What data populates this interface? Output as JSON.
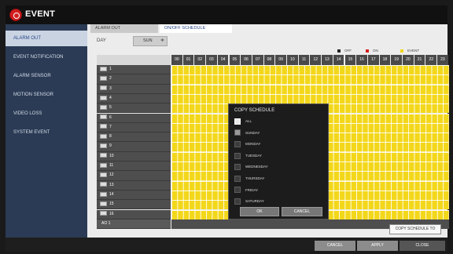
{
  "app": {
    "title": "EVENT"
  },
  "sidebar": {
    "items": [
      {
        "label": "ALARM OUT",
        "active": true
      },
      {
        "label": "EVENT NOTIFICATION"
      },
      {
        "label": "ALARM SENSOR"
      },
      {
        "label": "MOTION SENSOR"
      },
      {
        "label": "VIDEO LOSS"
      },
      {
        "label": "SYSTEM EVENT"
      }
    ]
  },
  "tabs": [
    {
      "label": "ALARM OUT"
    },
    {
      "label": "ON/OFF SCHEDULE",
      "active": true
    }
  ],
  "day": {
    "label": "DAY",
    "value": "SUN",
    "caret": "≑"
  },
  "legend": [
    {
      "label": "OFF",
      "color": "#222222"
    },
    {
      "label": "ON",
      "color": "#d21f1f"
    },
    {
      "label": "EVENT",
      "color": "#f3d71a"
    }
  ],
  "hours": [
    "00",
    "01",
    "02",
    "03",
    "04",
    "05",
    "06",
    "07",
    "08",
    "09",
    "10",
    "11",
    "12",
    "13",
    "14",
    "15",
    "16",
    "17",
    "18",
    "19",
    "20",
    "21",
    "22",
    "23"
  ],
  "rows": [
    "1",
    "2",
    "3",
    "4",
    "5",
    "6",
    "7",
    "8",
    "9",
    "10",
    "11",
    "12",
    "13",
    "14",
    "15",
    "16",
    "AO 1"
  ],
  "copy_schedule_button": "COPY SCHEDULE TO",
  "bottom": {
    "cancel": "CANCEL",
    "apply": "APPLY",
    "close": "CLOSE"
  },
  "dialog": {
    "title": "COPY SCHEDULE",
    "options": [
      {
        "label": "ALL",
        "state": "on"
      },
      {
        "label": "SUNDAY",
        "state": "dim"
      },
      {
        "label": "MONDAY",
        "state": "off"
      },
      {
        "label": "TUESDAY",
        "state": "off"
      },
      {
        "label": "WEDNESDAY",
        "state": "off"
      },
      {
        "label": "THURSDAY",
        "state": "off"
      },
      {
        "label": "FRIDAY",
        "state": "off"
      },
      {
        "label": "SATURDAY",
        "state": "off"
      }
    ],
    "ok": "OK",
    "cancel": "CANCEL"
  },
  "colors": {
    "event": "#f3d71a",
    "sidebar": "#2b3b55",
    "accent": "#d21f1f"
  }
}
